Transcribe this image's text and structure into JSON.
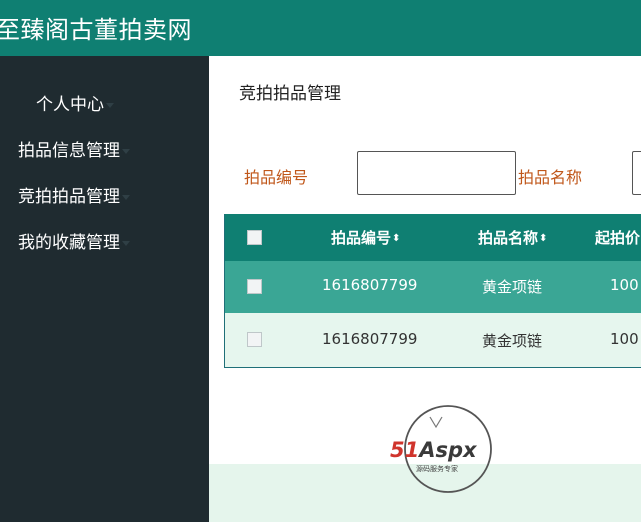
{
  "header": {
    "title": "至臻阁古董拍卖网"
  },
  "sidebar": {
    "items": [
      {
        "label": "个人中心"
      },
      {
        "label": "拍品信息管理"
      },
      {
        "label": "竞拍拍品管理"
      },
      {
        "label": "我的收藏管理"
      }
    ]
  },
  "main": {
    "heading": "竞拍拍品管理",
    "filters": {
      "item_no_label": "拍品编号",
      "item_no_value": "",
      "item_name_label": "拍品名称",
      "item_name_value": ""
    },
    "table": {
      "columns": [
        "拍品编号",
        "拍品名称",
        "起拍价"
      ],
      "rows": [
        {
          "item_no": "1616807799",
          "item_name": "黄金项链",
          "start_price": "100"
        },
        {
          "item_no": "1616807799",
          "item_name": "黄金项链",
          "start_price": "100"
        }
      ]
    }
  },
  "watermark": {
    "brand": "51Aspx",
    "tagline": "源码服务专家"
  },
  "colors": {
    "header": "#0f7f72",
    "sidebar": "#1f2b30",
    "row_highlight": "#3aa695",
    "row_alt": "#e6f6ee",
    "label": "#c0571a"
  }
}
